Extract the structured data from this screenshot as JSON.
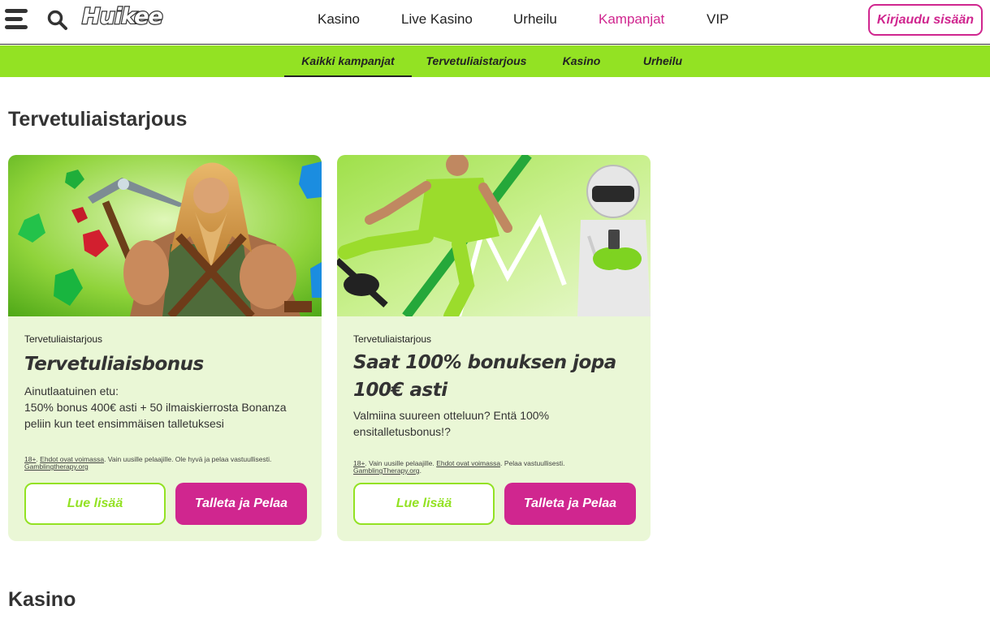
{
  "header": {
    "logo_text": "Huikee",
    "nav": [
      {
        "label": "Kasino"
      },
      {
        "label": "Live Kasino"
      },
      {
        "label": "Urheilu"
      },
      {
        "label": "Kampanjat",
        "active": true
      },
      {
        "label": "VIP"
      }
    ],
    "login_label": "Kirjaudu sisään"
  },
  "subnav": {
    "items": [
      {
        "label": "Kaikki kampanjat",
        "active": true
      },
      {
        "label": "Tervetuliaistarjous"
      },
      {
        "label": "Kasino"
      },
      {
        "label": "Urheilu"
      }
    ]
  },
  "sections": [
    {
      "title": "Tervetuliaistarjous"
    },
    {
      "title": "Kasino"
    }
  ],
  "cards": [
    {
      "category": "Tervetuliaistarjous",
      "title": "Tervetuliaisbonus",
      "desc_line1": "Ainutlaatuinen etu:",
      "desc_line2": "150% bonus 400€ asti + 50 ilmaiskierrosta Bonanza peliin kun teet ensimmäisen talletuksesi",
      "terms_age": "18+",
      "terms_link": "Ehdot ovat voimassa",
      "terms_text": ". Vain uusille pelaajille. Ole hyvä ja pelaa vastuullisesti.",
      "terms_site": "Gamblingtherapy.org",
      "read_more": "Lue lisää",
      "cta": "Talleta ja Pelaa"
    },
    {
      "category": "Tervetuliaistarjous",
      "title": "Saat 100% bonuksen jopa 100€ asti",
      "desc_line1": "Valmiina suureen otteluun? Entä 100% ensitalletusbonus!?",
      "terms_age": "18+",
      "terms_pre": "Vain uusille pelaajille.",
      "terms_link": "Ehdot ovat voimassa",
      "terms_text": ". Pelaa vastuullisesti.",
      "terms_site": "GamblingTherapy.org",
      "read_more": "Lue lisää",
      "cta": "Talleta ja Pelaa"
    }
  ],
  "colors": {
    "brand_pink": "#d0268f",
    "brand_green": "#93e223",
    "card_bg": "#eaf7d6"
  }
}
